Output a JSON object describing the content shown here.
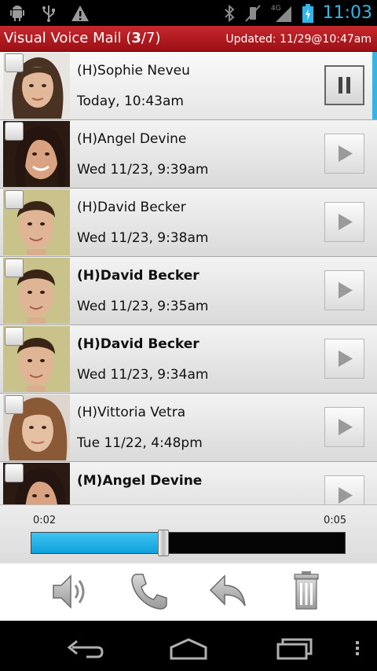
{
  "status_bar": {
    "time": "11:03",
    "network": "4G",
    "icons": [
      "android-debug-icon",
      "usb-icon",
      "warning-icon",
      "bluetooth-icon",
      "vibrate-muted-icon",
      "signal-icon",
      "battery-charging-icon"
    ]
  },
  "header": {
    "title_prefix": "Visual Voice Mail (",
    "title_current": "3",
    "title_suffix": "/7)",
    "updated": "Updated: 11/29@10:47am"
  },
  "messages": [
    {
      "name": "(H)Sophie Neveu",
      "time": "Today, 10:43am",
      "unread": false,
      "state": "playing"
    },
    {
      "name": "(H)Angel Devine",
      "time": "Wed  11/23, 9:39am",
      "unread": false,
      "state": "stopped"
    },
    {
      "name": "(H)David Becker",
      "time": "Wed  11/23, 9:38am",
      "unread": false,
      "state": "stopped"
    },
    {
      "name": "(H)David Becker",
      "time": "Wed  11/23, 9:35am",
      "unread": true,
      "state": "stopped"
    },
    {
      "name": "(H)David Becker",
      "time": "Wed  11/23, 9:34am",
      "unread": true,
      "state": "stopped"
    },
    {
      "name": "(H)Vittoria Vetra",
      "time": "Tue  11/22, 4:48pm",
      "unread": false,
      "state": "stopped"
    },
    {
      "name": "(M)Angel Devine",
      "time": "",
      "unread": true,
      "state": "stopped"
    }
  ],
  "player": {
    "elapsed": "0:02",
    "total": "0:05",
    "progress": 0.42
  },
  "actions": [
    "speaker-icon",
    "call-icon",
    "reply-icon",
    "trash-icon"
  ],
  "colors": {
    "accent": "#33b5e5",
    "header_red": "#b51c22",
    "progress_fill": "#1aaee6"
  }
}
